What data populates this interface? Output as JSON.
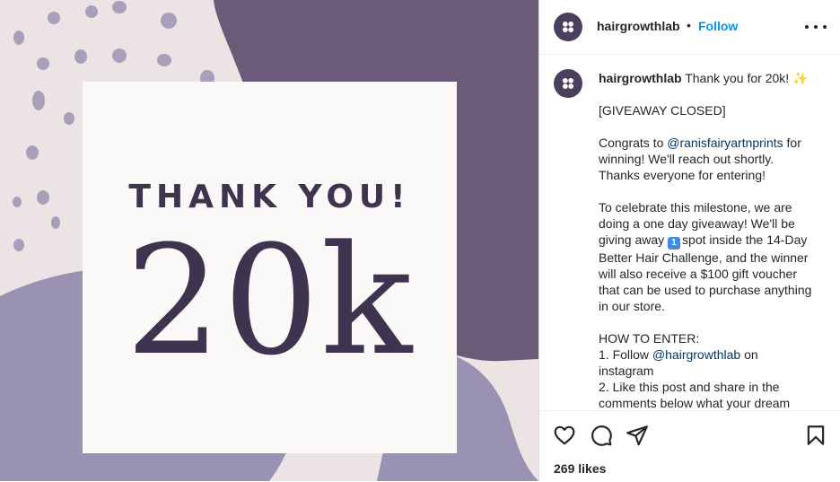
{
  "post": {
    "username": "hairgrowthlab",
    "separator": "•",
    "follow_label": "Follow",
    "image_text": {
      "line1": "THANK YOU!",
      "line2": "20k"
    },
    "caption": {
      "username": "hairgrowthlab",
      "title": "Thank you for 20k!",
      "sparkle": "✨",
      "closed": "[GIVEAWAY CLOSED]",
      "congrats_pre": "Congrats to ",
      "congrats_mention": "@ranisfairyartnprints",
      "congrats_post": " for winning! We'll reach out shortly. Thanks everyone for entering!",
      "celebrate_pre": "To celebrate this milestone, we are doing a one day giveaway! We'll be giving away ",
      "badge": "1",
      "celebrate_post": "spot inside the 14-Day Better Hair Challenge, and the winner will also receive a $100 gift voucher that can be used to purchase anything in our store.",
      "how_to": "HOW TO ENTER:",
      "step1_pre": "1. Follow ",
      "step1_mention": "@hairgrowthlab",
      "step1_post": " on instagram",
      "step2": "2. Like this post and share in the comments below what your dream"
    },
    "likes": "269 likes"
  },
  "colors": {
    "dark_purple": "#6b5a78",
    "lavender": "#9a92b3",
    "blush": "#ece3e4",
    "text_purple": "#3d3550",
    "follow_blue": "#0095f6",
    "mention_blue": "#00376b"
  },
  "icons": [
    "more-options-icon",
    "heart-icon",
    "comment-icon",
    "share-icon",
    "save-icon",
    "brand-logo-icon"
  ]
}
